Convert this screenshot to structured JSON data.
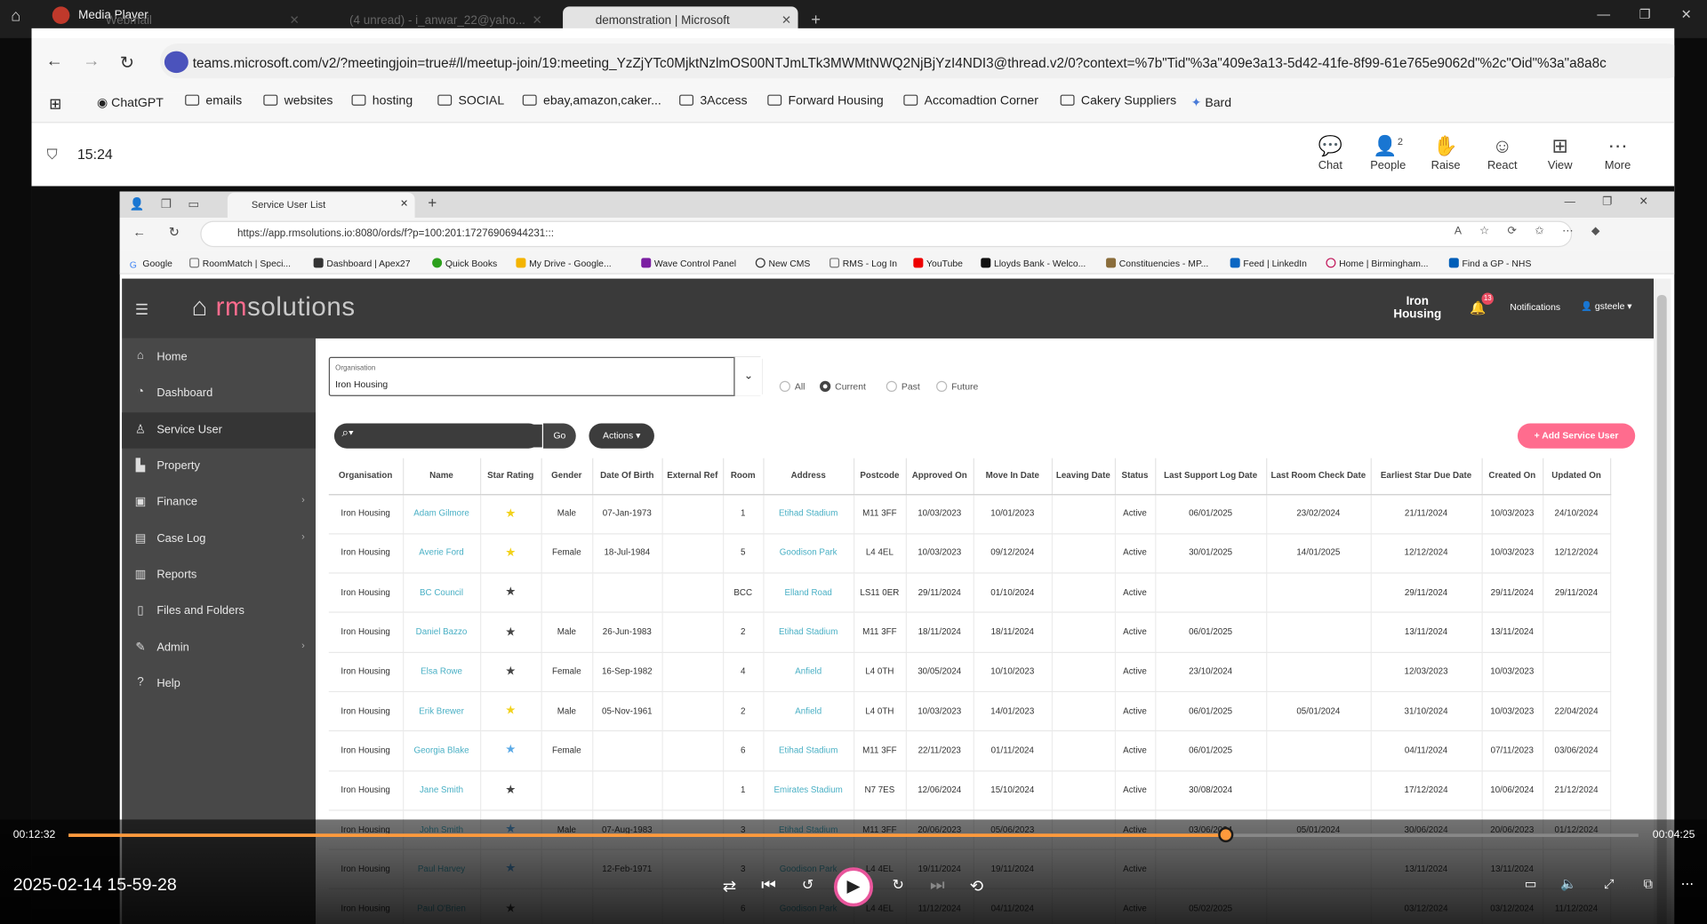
{
  "player": {
    "title": "Media Player",
    "current_time": "00:12:32",
    "remaining_time": "00:04:25",
    "video_title": "2025-02-14 15-59-28",
    "progress": 0.737
  },
  "host_tabs": [
    {
      "label": "Webmail"
    },
    {
      "label": "(4 unread) - i_anwar_22@yaho..."
    },
    {
      "label": "demonstration | Microsoft"
    }
  ],
  "host_url": "teams.microsoft.com/v2/?meetingjoin=true#/l/meetup-join/19:meeting_YzZjYTc0MjktNzlmOS00NTJmLTk3MWMtNWQ2NjBjYzI4NDI3@thread.v2/0?context=%7b\"Tid\"%3a\"409e3a13-5d42-41fe-8f99-61e765e9062d\"%2c\"Oid\"%3a\"a8a8c",
  "host_bookmarks": [
    "ChatGPT",
    "emails",
    "websites",
    "hosting",
    "SOCIAL",
    "ebay,amazon,caker...",
    "3Access",
    "Forward Housing",
    "Accomadtion Corner",
    "Cakery Suppliers",
    "Bard"
  ],
  "meeting": {
    "time": "15:24",
    "people_count": "2",
    "buttons": [
      "Chat",
      "People",
      "Raise",
      "React",
      "View",
      "More"
    ]
  },
  "browser": {
    "tab_label": "Service User List",
    "url": "https://app.rmsolutions.io:8080/ords/f?p=100:201:17276906944231:::",
    "bookmarks": [
      "Google",
      "RoomMatch | Speci...",
      "Dashboard | Apex27",
      "Quick Books",
      "My Drive - Google...",
      "Wave Control Panel",
      "New CMS",
      "RMS - Log In",
      "YouTube",
      "Lloyds Bank - Welco...",
      "Constituencies - MP...",
      "Feed | LinkedIn",
      "Home | Birmingham...",
      "Find a GP - NHS"
    ]
  },
  "app": {
    "logo_pre": "rm",
    "logo_post": "solutions",
    "org_name": "Iron Housing",
    "notif_count": "13",
    "notif_label": "Notifications",
    "user": "gsteele",
    "sidebar": [
      "Home",
      "Dashboard",
      "Service User",
      "Property",
      "Finance",
      "Case Log",
      "Reports",
      "Files and Folders",
      "Admin",
      "Help"
    ],
    "filter": {
      "org_label": "Organisation",
      "org_value": "Iron Housing",
      "radios": [
        "All",
        "Current",
        "Past",
        "Future"
      ]
    },
    "go_label": "Go",
    "actions_label": "Actions",
    "add_label": "Add Service User",
    "columns": [
      "Organisation",
      "Name",
      "Star Rating",
      "Gender",
      "Date Of Birth",
      "External Ref",
      "Room",
      "Address",
      "Postcode",
      "Approved On",
      "Move In Date",
      "Leaving Date",
      "Status",
      "Last Support Log Date",
      "Last Room Check Date",
      "Earliest Star Due Date",
      "Created On",
      "Updated On"
    ],
    "rows": [
      {
        "org": "Iron Housing",
        "name": "Adam Gilmore",
        "star": "yellow",
        "gender": "Male",
        "dob": "07-Jan-1973",
        "ext": "",
        "room": "1",
        "addr": "Etihad Stadium",
        "pc": "M11 3FF",
        "appr": "10/03/2023",
        "movein": "10/01/2023",
        "leave": "",
        "status": "Active",
        "lsl": "06/01/2025",
        "lrc": "23/02/2024",
        "esd": "21/11/2024",
        "created": "10/03/2023",
        "updated": "24/10/2024"
      },
      {
        "org": "Iron Housing",
        "name": "Averie Ford",
        "star": "yellow",
        "gender": "Female",
        "dob": "18-Jul-1984",
        "ext": "",
        "room": "5",
        "addr": "Goodison Park",
        "pc": "L4 4EL",
        "appr": "10/03/2023",
        "movein": "09/12/2024",
        "leave": "",
        "status": "Active",
        "lsl": "30/01/2025",
        "lrc": "14/01/2025",
        "esd": "12/12/2024",
        "created": "10/03/2023",
        "updated": "12/12/2024"
      },
      {
        "org": "Iron Housing",
        "name": "BC Council",
        "star": "dark",
        "gender": "",
        "dob": "",
        "ext": "",
        "room": "BCC",
        "addr": "Elland Road",
        "pc": "LS11 0ER",
        "appr": "29/11/2024",
        "movein": "01/10/2024",
        "leave": "",
        "status": "Active",
        "lsl": "",
        "lrc": "",
        "esd": "29/11/2024",
        "created": "29/11/2024",
        "updated": "29/11/2024"
      },
      {
        "org": "Iron Housing",
        "name": "Daniel Bazzo",
        "star": "dark",
        "gender": "Male",
        "dob": "26-Jun-1983",
        "ext": "",
        "room": "2",
        "addr": "Etihad Stadium",
        "pc": "M11 3FF",
        "appr": "18/11/2024",
        "movein": "18/11/2024",
        "leave": "",
        "status": "Active",
        "lsl": "06/01/2025",
        "lrc": "",
        "esd": "13/11/2024",
        "created": "13/11/2024",
        "updated": ""
      },
      {
        "org": "Iron Housing",
        "name": "Elsa Rowe",
        "star": "dark",
        "gender": "Female",
        "dob": "16-Sep-1982",
        "ext": "",
        "room": "4",
        "addr": "Anfield",
        "pc": "L4 0TH",
        "appr": "30/05/2024",
        "movein": "10/10/2023",
        "leave": "",
        "status": "Active",
        "lsl": "23/10/2024",
        "lrc": "",
        "esd": "12/03/2023",
        "created": "10/03/2023",
        "updated": ""
      },
      {
        "org": "Iron Housing",
        "name": "Erik Brewer",
        "star": "yellow",
        "gender": "Male",
        "dob": "05-Nov-1961",
        "ext": "",
        "room": "2",
        "addr": "Anfield",
        "pc": "L4 0TH",
        "appr": "10/03/2023",
        "movein": "14/01/2023",
        "leave": "",
        "status": "Active",
        "lsl": "06/01/2025",
        "lrc": "05/01/2024",
        "esd": "31/10/2024",
        "created": "10/03/2023",
        "updated": "22/04/2024"
      },
      {
        "org": "Iron Housing",
        "name": "Georgia Blake",
        "star": "blue",
        "gender": "Female",
        "dob": "",
        "ext": "",
        "room": "6",
        "addr": "Etihad Stadium",
        "pc": "M11 3FF",
        "appr": "22/11/2023",
        "movein": "01/11/2024",
        "leave": "",
        "status": "Active",
        "lsl": "06/01/2025",
        "lrc": "",
        "esd": "04/11/2024",
        "created": "07/11/2023",
        "updated": "03/06/2024"
      },
      {
        "org": "Iron Housing",
        "name": "Jane Smith",
        "star": "dark",
        "gender": "",
        "dob": "",
        "ext": "",
        "room": "1",
        "addr": "Emirates Stadium",
        "pc": "N7 7ES",
        "appr": "12/06/2024",
        "movein": "15/10/2024",
        "leave": "",
        "status": "Active",
        "lsl": "30/08/2024",
        "lrc": "",
        "esd": "17/12/2024",
        "created": "10/06/2024",
        "updated": "21/12/2024"
      },
      {
        "org": "Iron Housing",
        "name": "John Smith",
        "star": "blue",
        "gender": "Male",
        "dob": "07-Aug-1983",
        "ext": "",
        "room": "3",
        "addr": "Etihad Stadium",
        "pc": "M11 3FF",
        "appr": "20/06/2023",
        "movein": "05/06/2023",
        "leave": "",
        "status": "Active",
        "lsl": "03/06/2024",
        "lrc": "05/01/2024",
        "esd": "30/06/2024",
        "created": "20/06/2023",
        "updated": "01/12/2024"
      },
      {
        "org": "Iron Housing",
        "name": "Paul Harvey",
        "star": "blue",
        "gender": "",
        "dob": "12-Feb-1971",
        "ext": "",
        "room": "3",
        "addr": "Goodison Park",
        "pc": "L4 4EL",
        "appr": "19/11/2024",
        "movein": "19/11/2024",
        "leave": "",
        "status": "Active",
        "lsl": "",
        "lrc": "",
        "esd": "13/11/2024",
        "created": "13/11/2024",
        "updated": ""
      },
      {
        "org": "Iron Housing",
        "name": "Paul O'Brien",
        "star": "dark",
        "gender": "",
        "dob": "",
        "ext": "",
        "room": "6",
        "addr": "Goodison Park",
        "pc": "L4 4EL",
        "appr": "11/12/2024",
        "movein": "04/11/2024",
        "leave": "",
        "status": "Active",
        "lsl": "05/02/2025",
        "lrc": "",
        "esd": "03/12/2024",
        "created": "03/12/2024",
        "updated": "11/12/2024"
      }
    ]
  },
  "colors": {
    "accent_pink": "#ff6c8e",
    "link_teal": "#4ab0c5",
    "progress_orange": "#ff9a3c"
  }
}
